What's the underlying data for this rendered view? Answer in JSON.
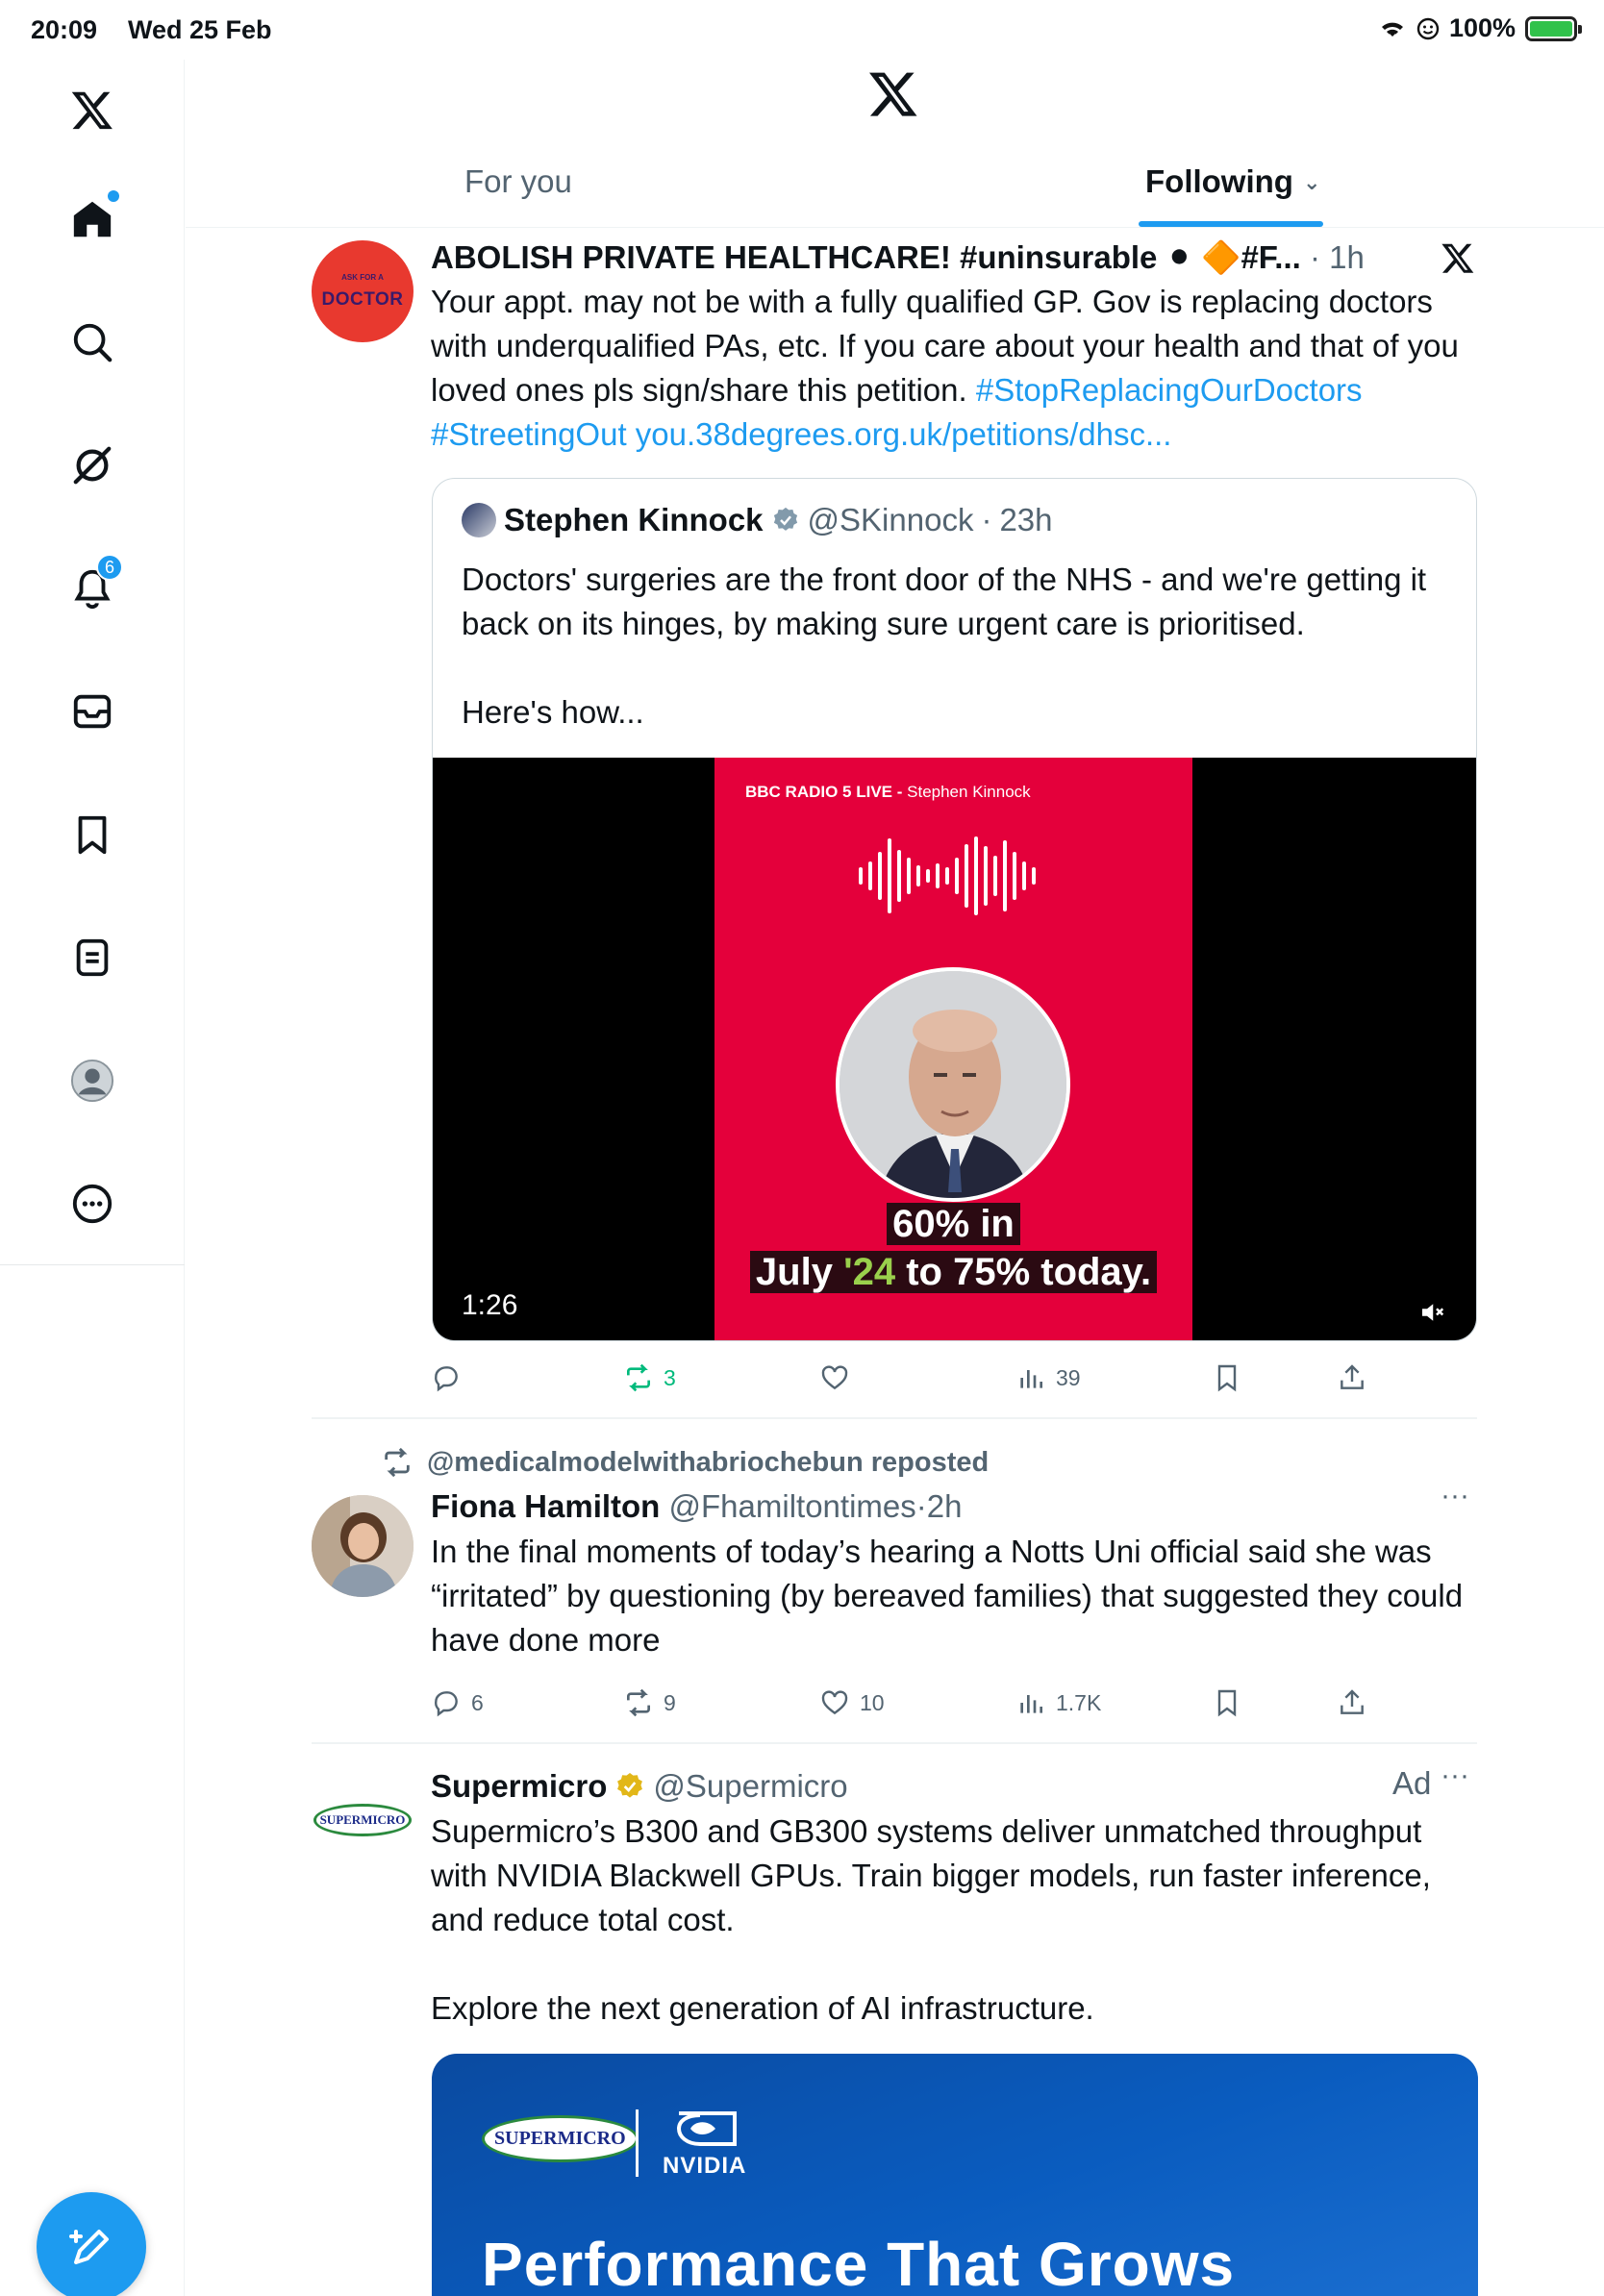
{
  "status_bar": {
    "time": "20:09",
    "date": "Wed 25 Feb",
    "battery": "100%"
  },
  "sidebar": {
    "items": [
      {
        "name": "home"
      },
      {
        "name": "search"
      },
      {
        "name": "grok"
      },
      {
        "name": "notifications",
        "badge": "6"
      },
      {
        "name": "messages"
      },
      {
        "name": "bookmarks"
      },
      {
        "name": "lists"
      },
      {
        "name": "profile"
      },
      {
        "name": "more"
      }
    ]
  },
  "header": {
    "tab_for_you": "For you",
    "tab_following": "Following",
    "chevron": "⌄"
  },
  "post1": {
    "avatar_text_small": "ASK FOR A",
    "avatar_text": "DOCTOR",
    "name": "ABOLISH PRIVATE HEALTHCARE! #uninsurable ⚫ 🔶#F...",
    "dot": "·",
    "time": "1h",
    "text_plain": "Your appt. may not be with a fully qualified GP. Gov is replacing doctors with underqualified PAs, etc. If you care about your health and that of you loved ones pls sign/share this petition. ",
    "hashtag1": "#StopReplacingOurDoctors",
    "hashtag2": "#StreetingOut",
    "url": "you.38degrees.org.uk/petitions/dhsc...",
    "quote": {
      "name": "Stephen Kinnock",
      "handle": "@SKinnock",
      "dot": "·",
      "time": "23h",
      "text1": "Doctors' surgeries are the front door of the NHS - and we're getting it back on its hinges, by making sure urgent care is prioritised.",
      "text2": "Here's how...",
      "video": {
        "header_bold": "BBC RADIO 5 LIVE -",
        "header_rest": " Stephen Kinnock",
        "caption1": "60% in",
        "caption2a": "July ",
        "caption2b": "'24",
        "caption2c": " to 75% today.",
        "duration": "1:26"
      }
    },
    "stats": {
      "replies": "",
      "reposts": "3",
      "likes": "",
      "views": "39"
    }
  },
  "post2": {
    "repost_by": "@medicalmodelwithabriochebun reposted",
    "name": "Fiona Hamilton",
    "handle": "@Fhamiltontimes",
    "dot": "·",
    "time": "2h",
    "more": "···",
    "text": "In the final moments of today’s hearing a Notts Uni official said she was “irritated” by questioning (by bereaved families) that suggested they could have done more",
    "stats": {
      "replies": "6",
      "reposts": "9",
      "likes": "10",
      "views": "1.7K"
    }
  },
  "post3": {
    "avatar_text": "SUPERMICRO",
    "name": "Supermicro",
    "handle": "@Supermicro",
    "ad_label": "Ad",
    "more": "···",
    "text1": "Supermicro’s B300 and GB300 systems deliver unmatched throughput with NVIDIA Blackwell GPUs. Train bigger models, run faster inference, and reduce total cost.",
    "text2": "Explore the next generation of AI infrastructure.",
    "card": {
      "logo1": "SUPERMICRO",
      "logo2": "NVIDIA",
      "headline": "Performance That Grows"
    }
  },
  "colors": {
    "accent": "#1d9bf0",
    "repost_green": "#00ba7c",
    "video_red": "#e4003b"
  }
}
